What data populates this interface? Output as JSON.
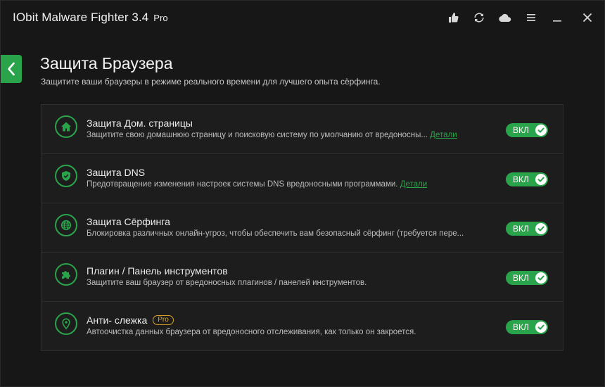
{
  "titlebar": {
    "app_name": "IObit Malware Fighter 3.4",
    "edition": "Pro",
    "icons": [
      "thumbs-up-icon",
      "update-icon",
      "cloud-icon",
      "menu-icon",
      "minimize-icon",
      "close-icon"
    ]
  },
  "page": {
    "title": "Защита Браузера",
    "subtitle": "Защитите ваши браузеры в режиме реального времени для лучшего опыта сёрфинга."
  },
  "colors": {
    "accent": "#2aa44a",
    "pro_badge": "#d9a326",
    "background": "#171717"
  },
  "features": [
    {
      "icon": "home-icon",
      "title": "Защита Дом. страницы",
      "description": "Защитите свою домашнюю страницу и поисковую систему по умолчанию от вредоносны...",
      "details_link": "Детали",
      "toggle": "ВКЛ",
      "enabled": true
    },
    {
      "icon": "shield-icon",
      "title": "Защита DNS",
      "description": "Предотвращение изменения настроек системы DNS вредоносными программами.",
      "details_link": "Детали",
      "toggle": "ВКЛ",
      "enabled": true
    },
    {
      "icon": "globe-icon",
      "title": "Защита Сёрфинга",
      "description": "Блокировка различных онлайн-угроз, чтобы обеспечить вам безопасный сёрфинг (требуется пере...",
      "toggle": "ВКЛ",
      "enabled": true
    },
    {
      "icon": "puzzle-icon",
      "title": "Плагин / Панель инструментов",
      "description": "Защитите ваш браузер от вредоносных плагинов / панелей инструментов.",
      "toggle": "ВКЛ",
      "enabled": true
    },
    {
      "icon": "location-pin-icon",
      "title": "Анти- слежка",
      "badge": "Pro",
      "description": "Автоочистка данных браузера от вредоносного отслеживания, как только он закроется.",
      "toggle": "ВКЛ",
      "enabled": true
    }
  ]
}
